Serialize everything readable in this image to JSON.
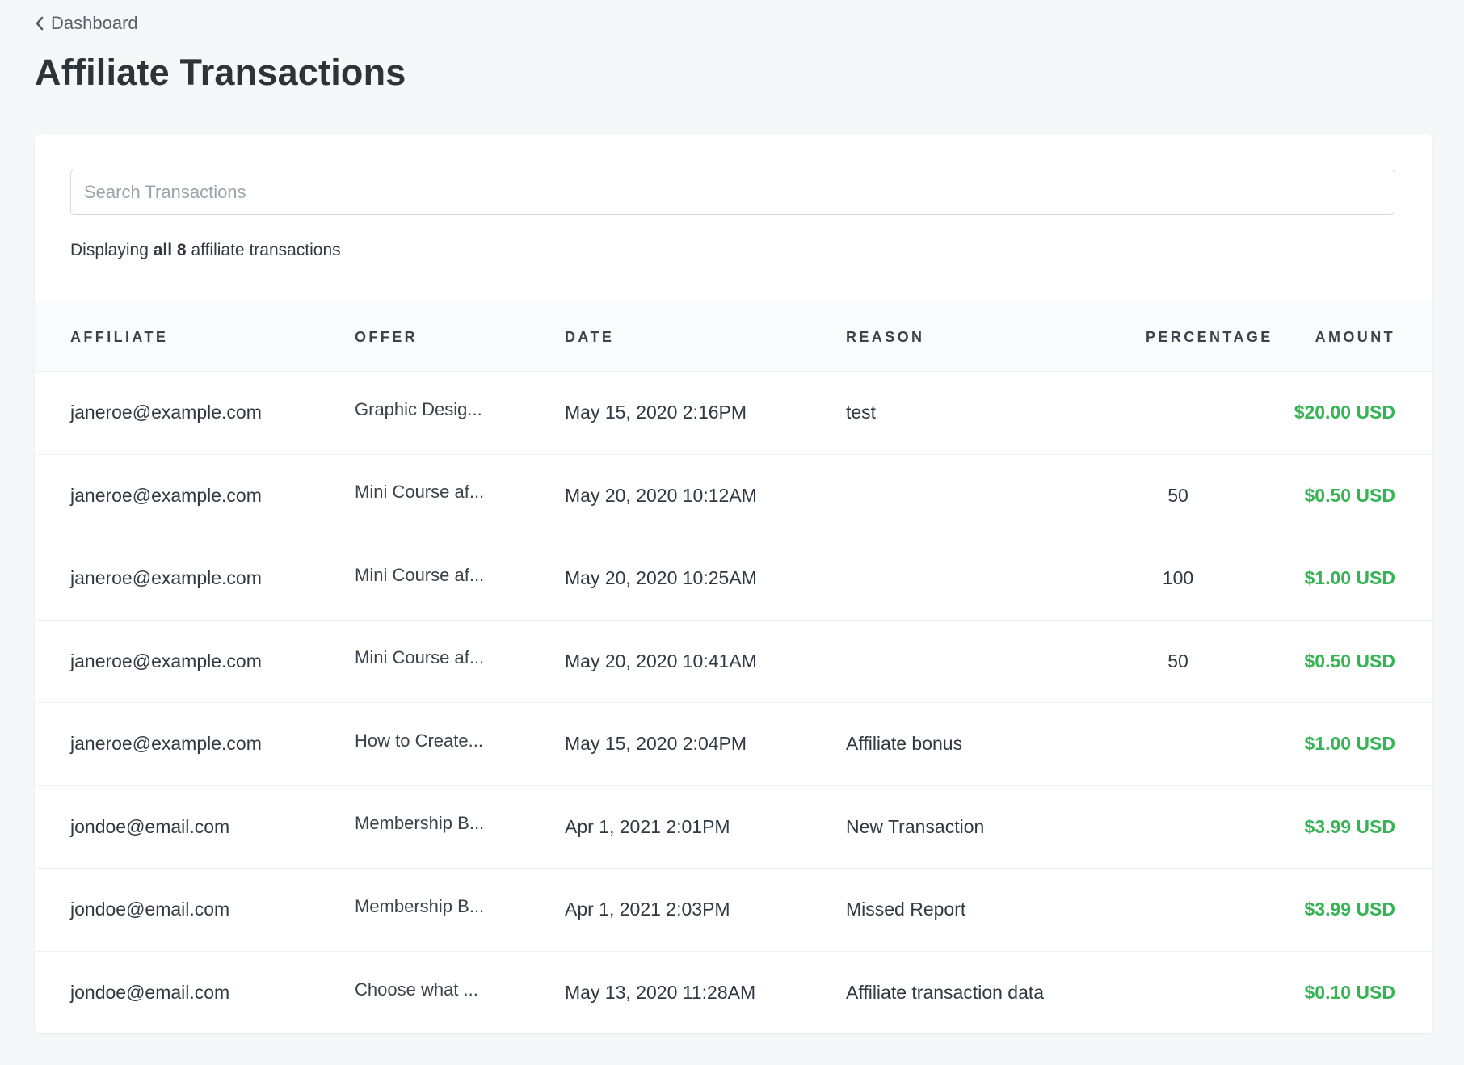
{
  "nav": {
    "back_label": "Dashboard"
  },
  "page": {
    "title": "Affiliate Transactions"
  },
  "search": {
    "placeholder": "Search Transactions",
    "value": ""
  },
  "summary": {
    "prefix": "Displaying",
    "count_bold": "all 8",
    "suffix": "affiliate transactions"
  },
  "table": {
    "columns": [
      "AFFILIATE",
      "OFFER",
      "DATE",
      "REASON",
      "PERCENTAGE",
      "AMOUNT"
    ],
    "rows": [
      {
        "affiliate": "janeroe@example.com",
        "offer": "Graphic Desig...",
        "date": "May 15, 2020 2:16PM",
        "reason": "test",
        "percentage": "",
        "amount": "$20.00 USD"
      },
      {
        "affiliate": "janeroe@example.com",
        "offer": "Mini Course af...",
        "date": "May 20, 2020 10:12AM",
        "reason": "",
        "percentage": "50",
        "amount": "$0.50 USD"
      },
      {
        "affiliate": "janeroe@example.com",
        "offer": "Mini Course af...",
        "date": "May 20, 2020 10:25AM",
        "reason": "",
        "percentage": "100",
        "amount": "$1.00 USD"
      },
      {
        "affiliate": "janeroe@example.com",
        "offer": "Mini Course af...",
        "date": "May 20, 2020 10:41AM",
        "reason": "",
        "percentage": "50",
        "amount": "$0.50 USD"
      },
      {
        "affiliate": "janeroe@example.com",
        "offer": "How to Create...",
        "date": "May 15, 2020 2:04PM",
        "reason": "Affiliate bonus",
        "percentage": "",
        "amount": "$1.00 USD"
      },
      {
        "affiliate": "jondoe@email.com",
        "offer": "Membership B...",
        "date": "Apr 1, 2021 2:01PM",
        "reason": "New Transaction",
        "percentage": "",
        "amount": "$3.99 USD"
      },
      {
        "affiliate": "jondoe@email.com",
        "offer": "Membership B...",
        "date": "Apr 1, 2021 2:03PM",
        "reason": "Missed Report",
        "percentage": "",
        "amount": "$3.99 USD"
      },
      {
        "affiliate": "jondoe@email.com",
        "offer": "Choose what ...",
        "date": "May 13, 2020 11:28AM",
        "reason": "Affiliate transaction data",
        "percentage": "",
        "amount": "$0.10 USD"
      }
    ]
  },
  "icons": {
    "back": "chevron-left-icon"
  },
  "colors": {
    "background": "#f6f7f9",
    "card": "#ffffff",
    "amount": "#35b454",
    "text": "#303942"
  }
}
